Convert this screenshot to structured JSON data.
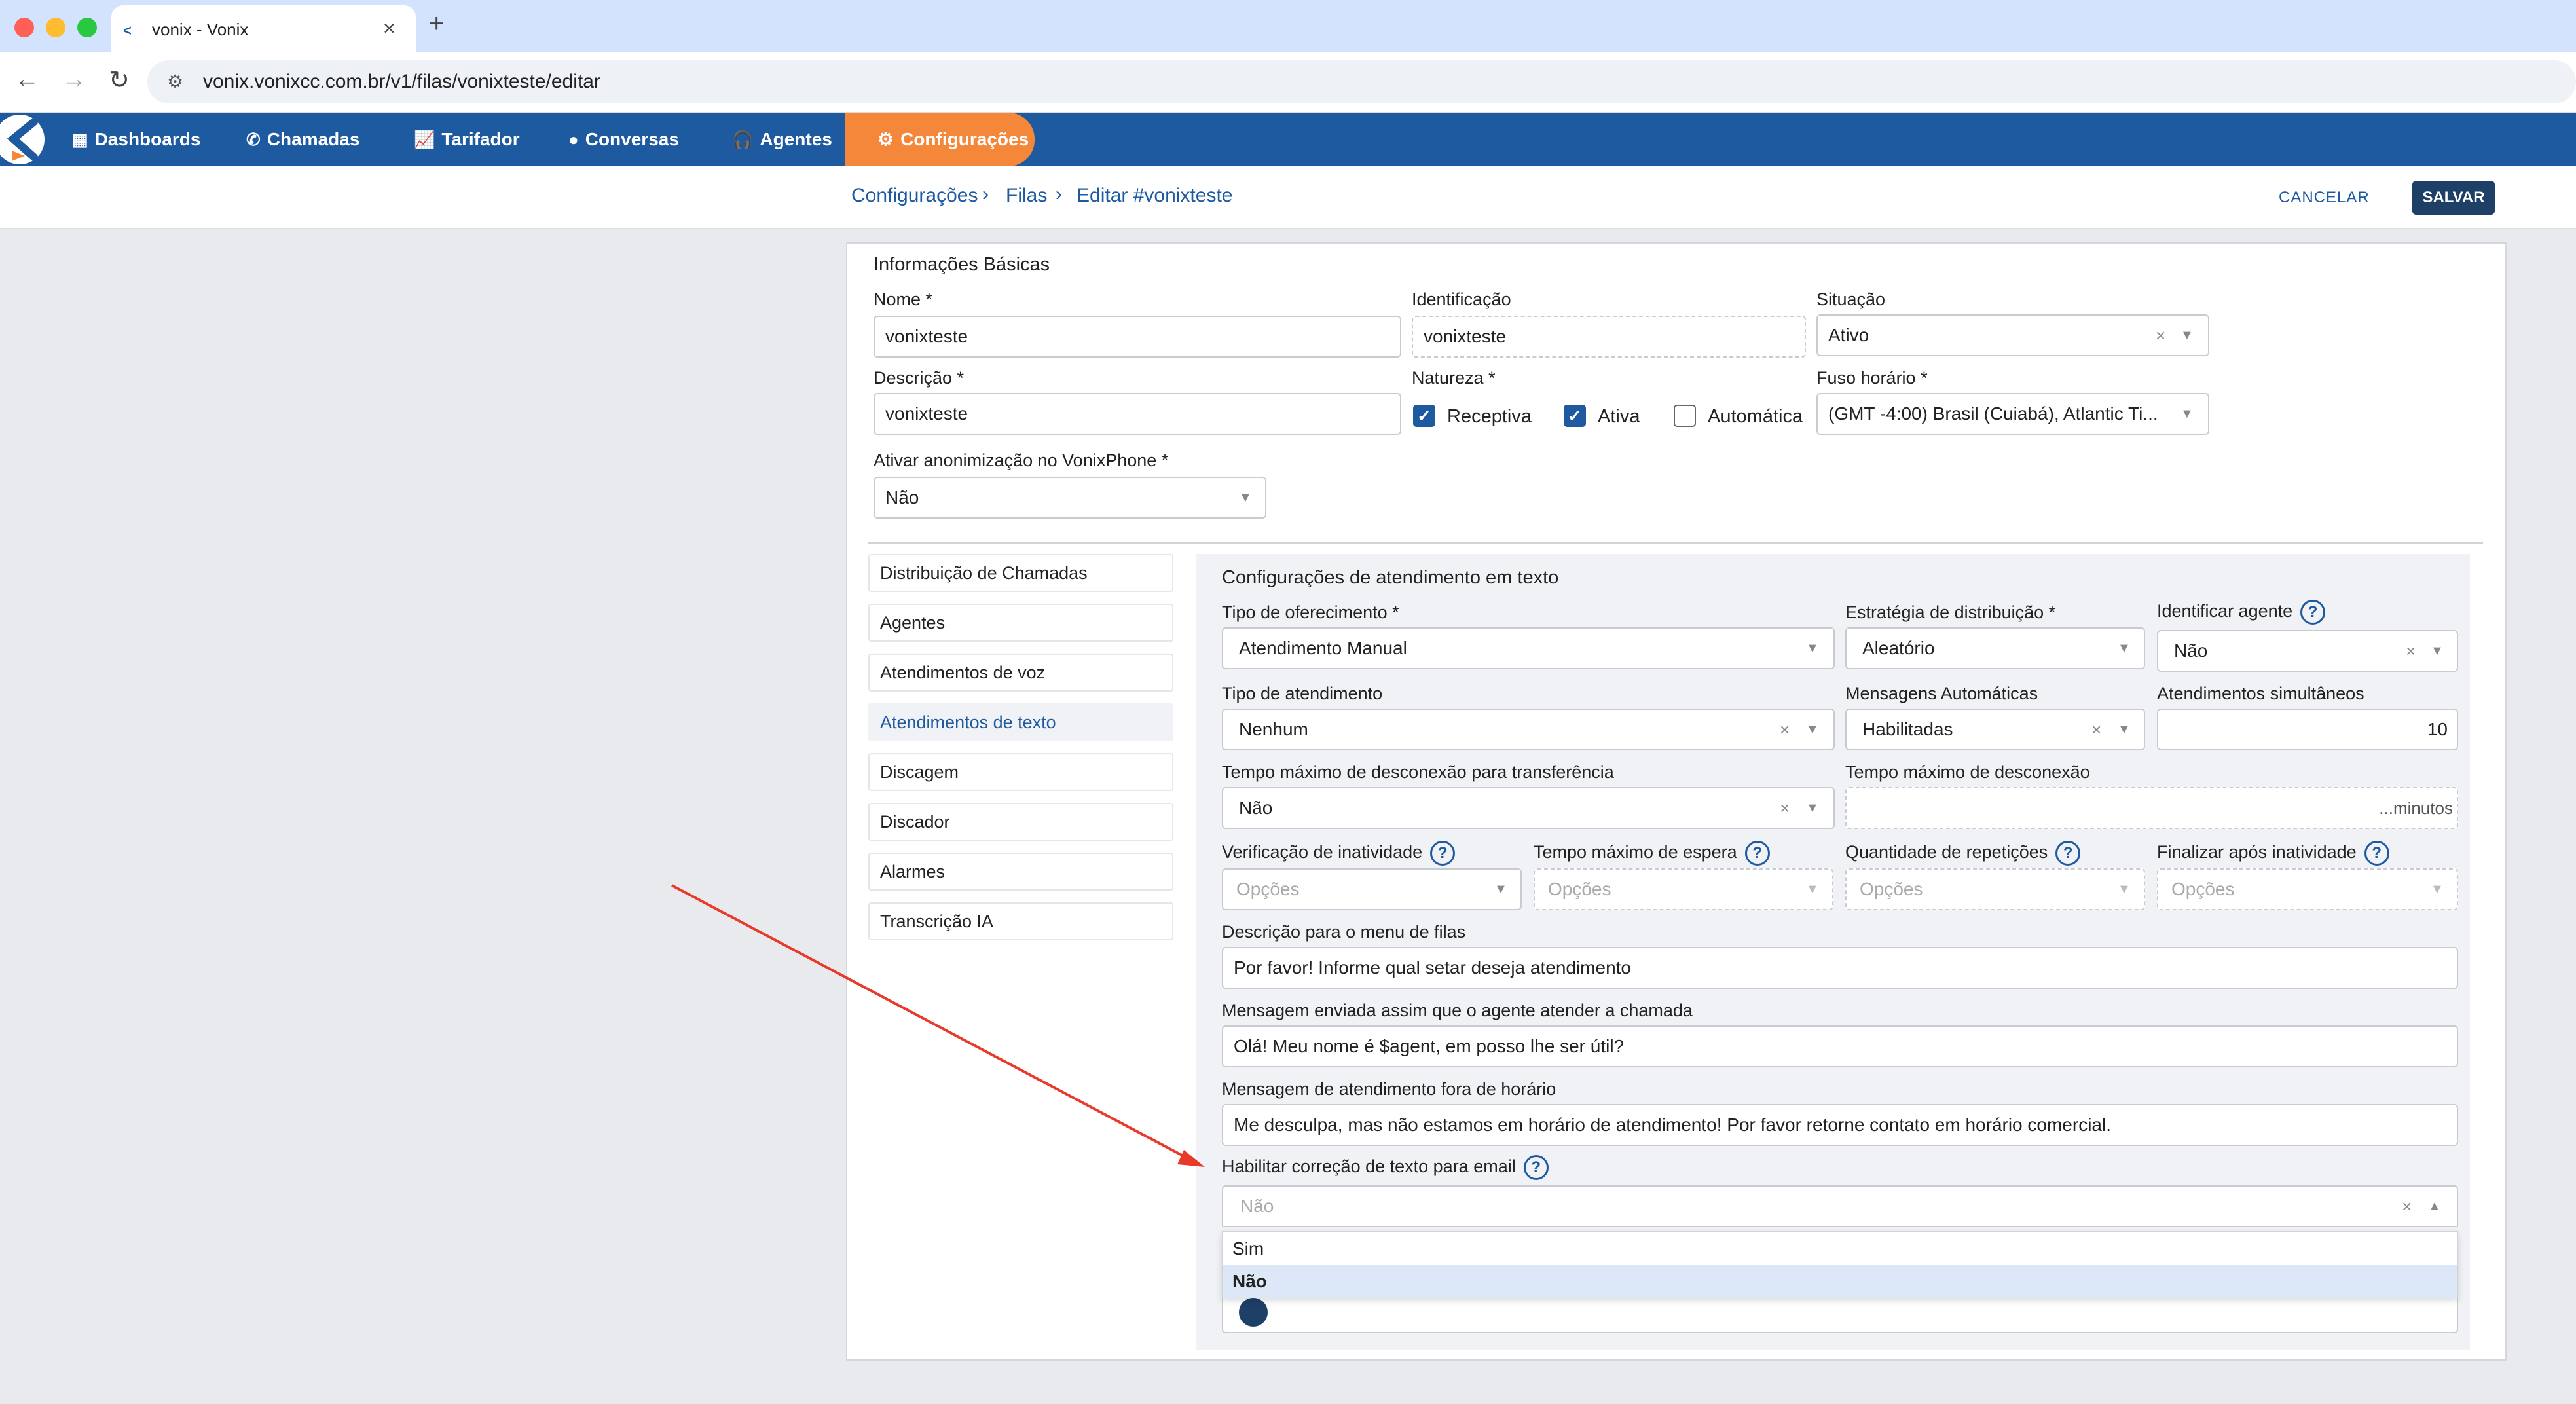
{
  "browser": {
    "tab_title": "vonix - Vonix",
    "url": "vonix.vonixcc.com.br/v1/filas/vonixteste/editar"
  },
  "nav": {
    "items": [
      "Dashboards",
      "Chamadas",
      "Tarifador",
      "Conversas",
      "Agentes"
    ],
    "active": "Configurações"
  },
  "breadcrumb": [
    "Configurações",
    "Filas",
    "Editar #vonixteste"
  ],
  "actions": {
    "cancel": "CANCELAR",
    "save": "SALVAR"
  },
  "basic": {
    "section_title": "Informações Básicas",
    "nome_label": "Nome *",
    "nome_value": "vonixteste",
    "ident_label": "Identificação",
    "ident_value": "vonixteste",
    "situacao_label": "Situação",
    "situacao_value": "Ativo",
    "descricao_label": "Descrição *",
    "descricao_value": "vonixteste",
    "natureza_label": "Natureza *",
    "natureza": {
      "receptiva": "Receptiva",
      "ativa": "Ativa",
      "automatica": "Automática"
    },
    "fuso_label": "Fuso horário *",
    "fuso_value": "(GMT -4:00) Brasil (Cuiabá), Atlantic Ti...",
    "anon_label": "Ativar anonimização no VonixPhone *",
    "anon_value": "Não"
  },
  "sidebar": [
    "Distribuição de Chamadas",
    "Agentes",
    "Atendimentos de voz",
    "Atendimentos de texto",
    "Discagem",
    "Discador",
    "Alarmes",
    "Transcrição IA"
  ],
  "text": {
    "title": "Configurações de atendimento em texto",
    "tipo_oferecimento_label": "Tipo de oferecimento *",
    "tipo_oferecimento_value": "Atendimento Manual",
    "estrategia_label": "Estratégia de distribuição *",
    "estrategia_value": "Aleatório",
    "identificar_label": "Identificar agente",
    "identificar_value": "Não",
    "tipo_atendimento_label": "Tipo de atendimento",
    "tipo_atendimento_value": "Nenhum",
    "mensagens_label": "Mensagens Automáticas",
    "mensagens_value": "Habilitadas",
    "simultaneos_label": "Atendimentos simultâneos",
    "simultaneos_value": "10",
    "desc_transf_label": "Tempo máximo de desconexão para transferência",
    "desc_transf_value": "Não",
    "desc_label": "Tempo máximo de desconexão",
    "desc_suffix": "...minutos",
    "verif_label": "Verificação de inatividade",
    "espera_label": "Tempo máximo de espera",
    "repeticoes_label": "Quantidade de repetições",
    "finalizar_label": "Finalizar após inatividade",
    "opcoes_placeholder": "Opções",
    "menu_label": "Descrição para o menu de filas",
    "menu_value": "Por favor! Informe qual setar deseja atendimento",
    "agente_msg_label": "Mensagem enviada assim que o agente atender a chamada",
    "agente_msg_value": "Olá! Meu nome é $agent, em posso lhe ser útil?",
    "fora_label": "Mensagem de atendimento fora de horário",
    "fora_value": "Me desculpa, mas não estamos em horário de atendimento! Por favor retorne contato em horário comercial.",
    "correcao_label": "Habilitar correção de texto para email",
    "correcao_value": "Não",
    "dropdown_options": [
      "Sim",
      "Não"
    ]
  },
  "help_glyph": "?",
  "annotation": {
    "arrow_color": "#e8392b"
  }
}
